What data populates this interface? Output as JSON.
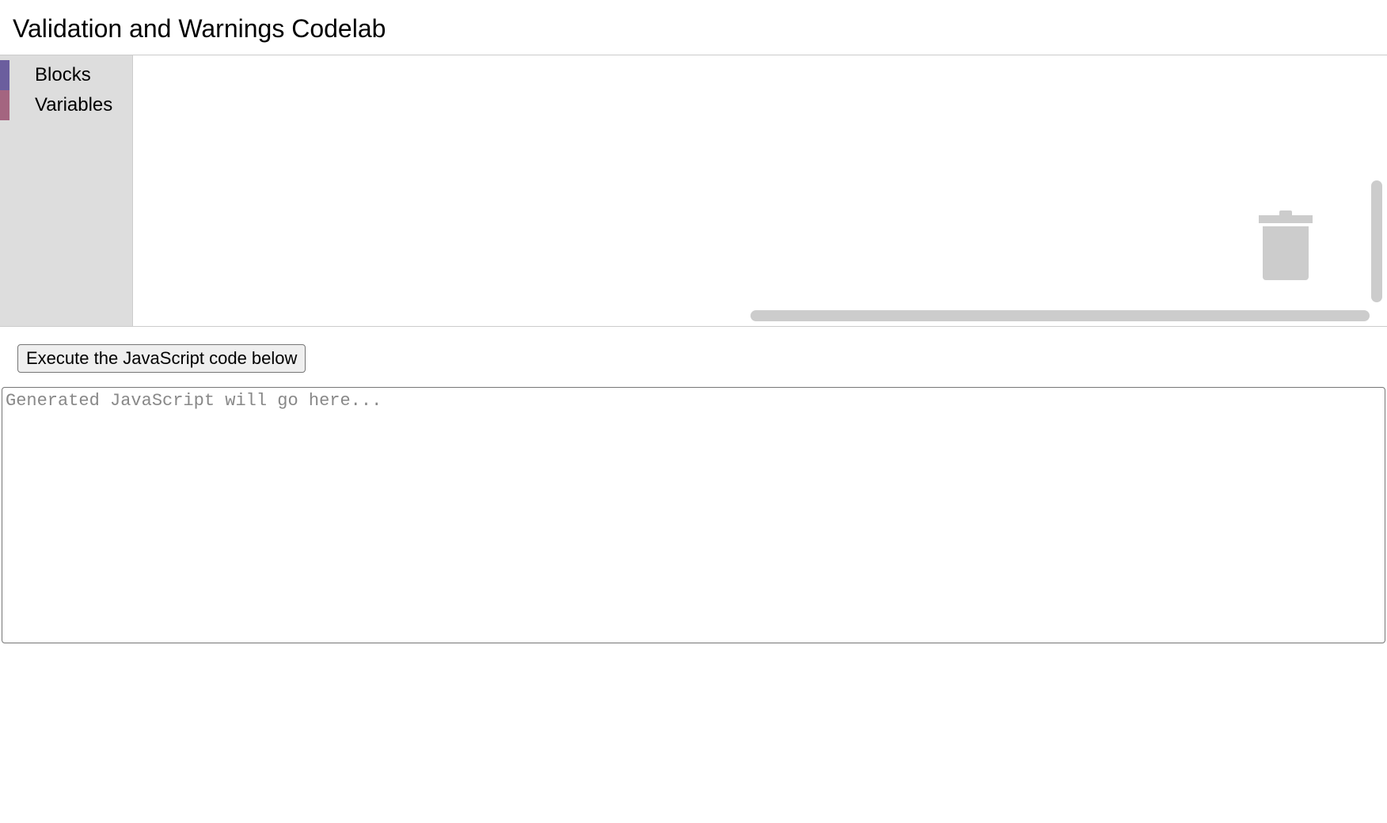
{
  "header": {
    "title": "Validation and Warnings Codelab"
  },
  "toolbox": {
    "items": [
      {
        "label": "Blocks",
        "color": "#6b5e9e"
      },
      {
        "label": "Variables",
        "color": "#a46580"
      }
    ]
  },
  "controls": {
    "execute_label": "Execute the JavaScript code below"
  },
  "output": {
    "placeholder": "Generated JavaScript will go here...",
    "value": ""
  }
}
